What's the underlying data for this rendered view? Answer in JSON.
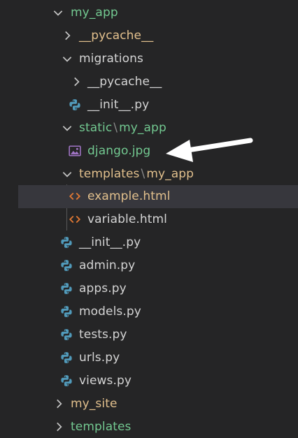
{
  "explorer": {
    "rows": [
      {
        "label": "my_app",
        "kind": "folder-open",
        "color": "#73c991"
      },
      {
        "label": "__pycache__",
        "kind": "folder-closed",
        "color": "#e2c08d"
      },
      {
        "label": "migrations",
        "kind": "folder-open",
        "color": "#d4d4d4"
      },
      {
        "label": "__pycache__",
        "kind": "folder-closed",
        "color": "#d4d4d4"
      },
      {
        "label": "__init__.py",
        "kind": "python-file",
        "color": "#d4d4d4"
      },
      {
        "label_a": "static",
        "separator": "\\",
        "label_b": "my_app",
        "kind": "folder-open",
        "color": "#73c991"
      },
      {
        "label": "django.jpg",
        "kind": "image-file",
        "color": "#73c991"
      },
      {
        "label_a": "templates",
        "separator": "\\",
        "label_b": "my_app",
        "kind": "folder-open",
        "color": "#e2c08d"
      },
      {
        "label": "example.html",
        "kind": "html-file",
        "color": "#e2c08d",
        "selected": true
      },
      {
        "label": "variable.html",
        "kind": "html-file",
        "color": "#d4d4d4"
      },
      {
        "label": "__init__.py",
        "kind": "python-file",
        "color": "#d4d4d4"
      },
      {
        "label": "admin.py",
        "kind": "python-file",
        "color": "#d4d4d4"
      },
      {
        "label": "apps.py",
        "kind": "python-file",
        "color": "#d4d4d4"
      },
      {
        "label": "models.py",
        "kind": "python-file",
        "color": "#d4d4d4"
      },
      {
        "label": "tests.py",
        "kind": "python-file",
        "color": "#d4d4d4"
      },
      {
        "label": "urls.py",
        "kind": "python-file",
        "color": "#d4d4d4"
      },
      {
        "label": "views.py",
        "kind": "python-file",
        "color": "#d4d4d4"
      },
      {
        "label": "my_site",
        "kind": "folder-closed",
        "color": "#e2c08d"
      },
      {
        "label": "templates",
        "kind": "folder-closed",
        "color": "#73c991"
      }
    ]
  },
  "colors": {
    "background": "#252526",
    "selection": "#37373d",
    "python_blue": "#519aba",
    "html_orange": "#e37933",
    "image_purple": "#a074c4",
    "annotation_arrow": "#ffffff"
  },
  "annotation": {
    "icon": "arrow-pointer-icon"
  }
}
